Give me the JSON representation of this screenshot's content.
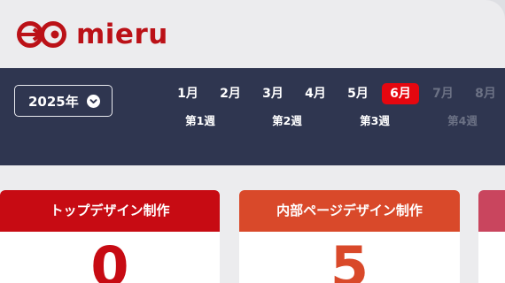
{
  "brand": {
    "name": "mieru"
  },
  "navbar": {
    "year_label": "2025年",
    "months": [
      {
        "label": "1月",
        "state": "normal"
      },
      {
        "label": "2月",
        "state": "normal"
      },
      {
        "label": "3月",
        "state": "normal"
      },
      {
        "label": "4月",
        "state": "normal"
      },
      {
        "label": "5月",
        "state": "normal"
      },
      {
        "label": "6月",
        "state": "active"
      },
      {
        "label": "7月",
        "state": "disabled"
      },
      {
        "label": "8月",
        "state": "disabled"
      }
    ],
    "weeks": [
      {
        "label": "第1週",
        "state": "normal"
      },
      {
        "label": "第2週",
        "state": "normal"
      },
      {
        "label": "第3週",
        "state": "normal"
      },
      {
        "label": "第4週",
        "state": "disabled"
      }
    ]
  },
  "cards": [
    {
      "title": "トップデザイン制作",
      "value": "0",
      "color": "#c70b13"
    },
    {
      "title": "内部ページデザイン制作",
      "value": "5",
      "color": "#d9492a"
    },
    {
      "title": "",
      "value": "",
      "color": "#c9455e"
    }
  ],
  "colors": {
    "brand": "#bb1117",
    "navbar": "#2f3650",
    "active_month": "#e5070f"
  }
}
